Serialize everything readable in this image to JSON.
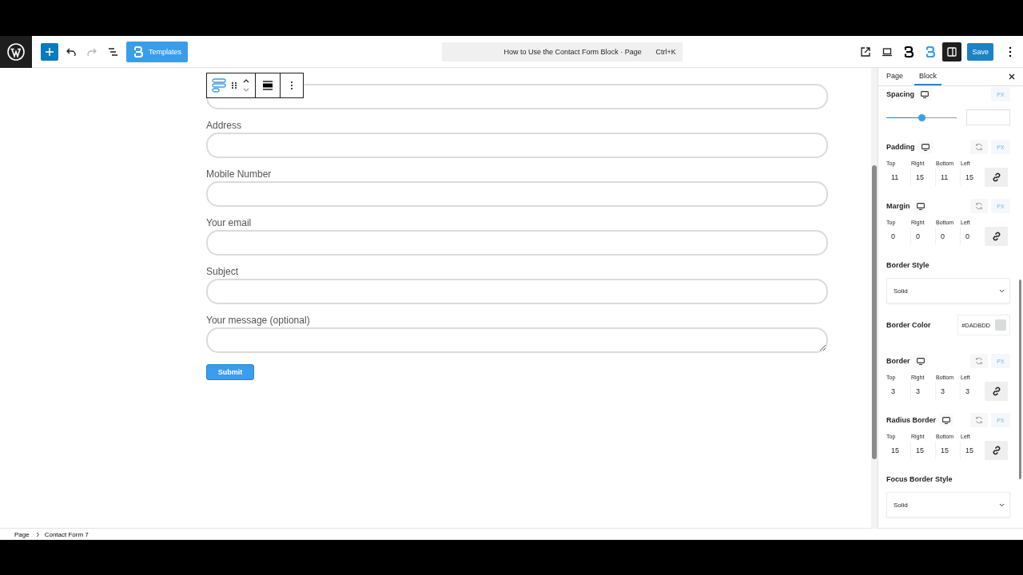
{
  "toolbar": {
    "templates_button": "Templates",
    "document_title": "How to Use the Contact Form Block · Page",
    "shortcut": "Ctrl+K",
    "save_button": "Save",
    "redo": {
      "disabled": true
    }
  },
  "form": {
    "fields": [
      {
        "kind": "input"
      },
      {
        "kind": "input",
        "label": "Address"
      },
      {
        "kind": "input",
        "label": "Mobile Number"
      },
      {
        "kind": "input",
        "label": "Your email"
      },
      {
        "kind": "input",
        "label": "Subject"
      },
      {
        "kind": "textarea",
        "label": "Your message (optional)"
      }
    ],
    "submit_button": "Submit"
  },
  "sidebar": {
    "tabs": [
      {
        "label": "Page",
        "selected": false
      },
      {
        "label": "Block",
        "selected": true
      }
    ],
    "sections": [
      {
        "kind": "slider",
        "title": "Spacing",
        "unit": "PX",
        "level": 0.5
      },
      {
        "kind": "sides",
        "title": "Padding",
        "unit": "PX",
        "sides": [
          {
            "label": "Top",
            "value": "11"
          },
          {
            "label": "Right",
            "value": "15"
          },
          {
            "label": "Bottom",
            "value": "11"
          },
          {
            "label": "Left",
            "value": "15"
          }
        ]
      },
      {
        "kind": "sides",
        "title": "Margin",
        "unit": "PX",
        "sides": [
          {
            "label": "Top",
            "value": "0"
          },
          {
            "label": "Right",
            "value": "0"
          },
          {
            "label": "Bottom",
            "value": "0"
          },
          {
            "label": "Left",
            "value": "0"
          }
        ]
      },
      {
        "kind": "select",
        "title": "Border Style",
        "value": "Solid"
      },
      {
        "kind": "color",
        "title": "Border Color",
        "value": "#DADBDD",
        "color": "#dadbdd"
      },
      {
        "kind": "sides",
        "title": "Border",
        "unit": "PX",
        "sides": [
          {
            "label": "Top",
            "value": "3"
          },
          {
            "label": "Right",
            "value": "3"
          },
          {
            "label": "Bottom",
            "value": "3"
          },
          {
            "label": "Left",
            "value": "3"
          }
        ]
      },
      {
        "kind": "sides",
        "title": "Radius Border",
        "unit": "PX",
        "sides": [
          {
            "label": "Top",
            "value": "15"
          },
          {
            "label": "Right",
            "value": "15"
          },
          {
            "label": "Bottom",
            "value": "15"
          },
          {
            "label": "Left",
            "value": "15"
          }
        ]
      },
      {
        "kind": "select",
        "title": "Focus Border Style",
        "value": "Solid"
      }
    ]
  },
  "breadcrumb": [
    "Page",
    "Contact Form 7"
  ]
}
